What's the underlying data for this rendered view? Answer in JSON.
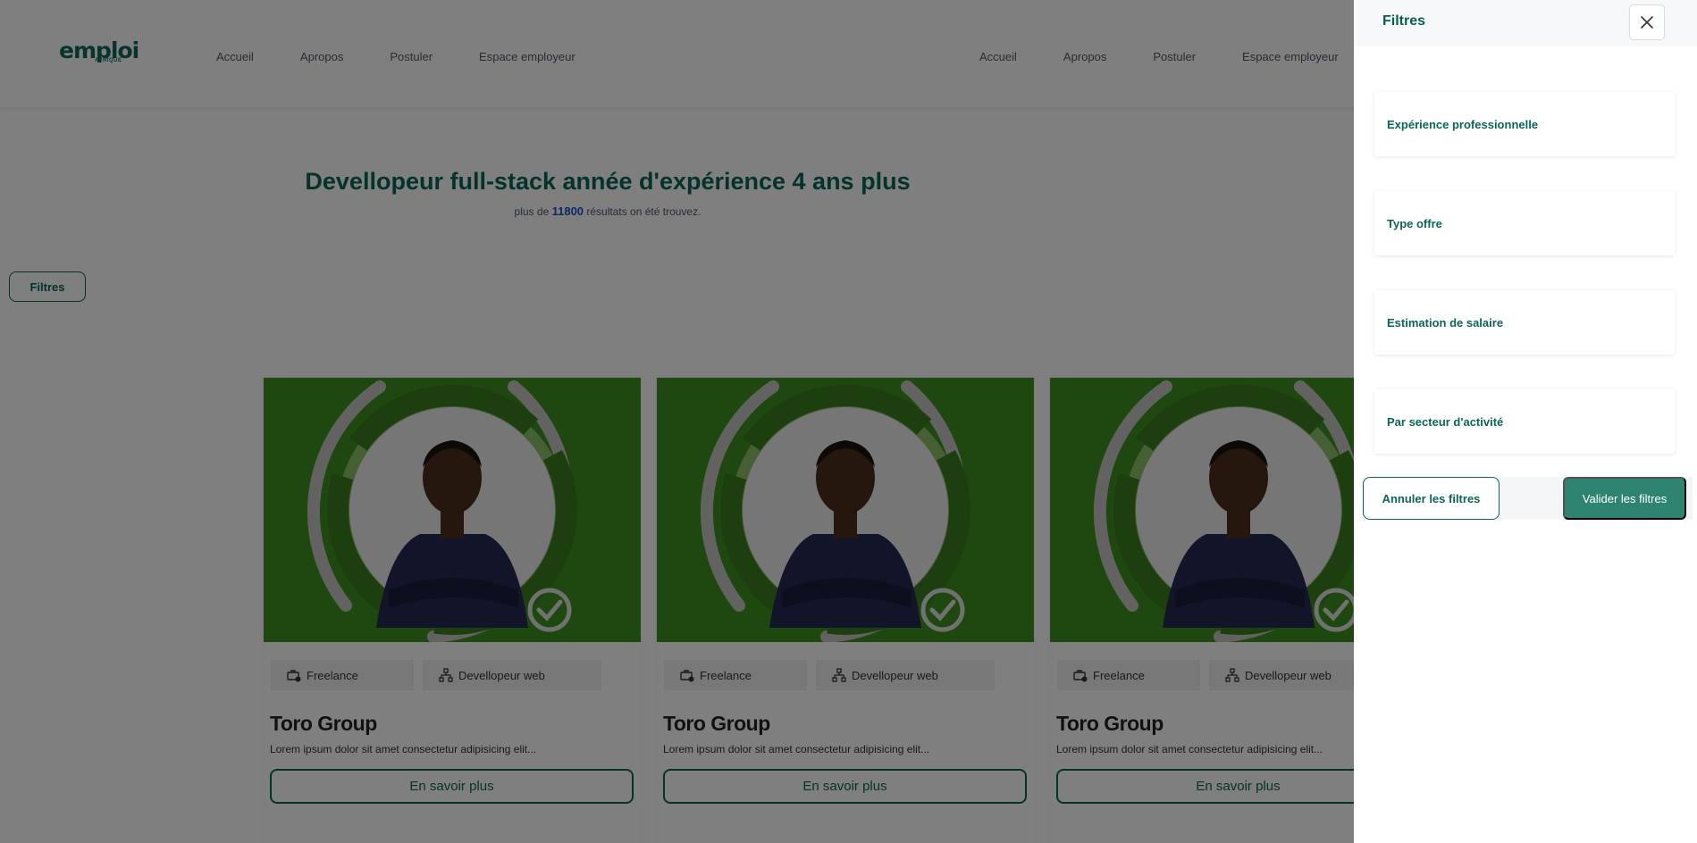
{
  "header": {
    "logo_text": "emploi",
    "logo_sub": "AFRIQUE",
    "nav_left": [
      "Accueil",
      "Apropos",
      "Postuler",
      "Espace employeur"
    ],
    "nav_right": [
      "Accueil",
      "Apropos",
      "Postuler",
      "Espace employeur"
    ]
  },
  "hero": {
    "title": "Devellopeur full-stack année d'expérience 4 ans plus",
    "sub_prefix": "plus de",
    "count": "11800",
    "sub_suffix": "résultats on été trouvez."
  },
  "filters_button": "Filtres",
  "cards": [
    {
      "tag1": "Freelance",
      "tag2": "Devellopeur web",
      "title": "Toro Group",
      "desc": "Lorem ipsum dolor sit amet consectetur adipisicing elit...",
      "button": "En savoir plus"
    },
    {
      "tag1": "Freelance",
      "tag2": "Devellopeur web",
      "title": "Toro Group",
      "desc": "Lorem ipsum dolor sit amet consectetur adipisicing elit...",
      "button": "En savoir plus"
    },
    {
      "tag1": "Freelance",
      "tag2": "Devellopeur web",
      "title": "Toro Group",
      "desc": "Lorem ipsum dolor sit amet consectetur adipisicing elit...",
      "button": "En savoir plus"
    }
  ],
  "drawer": {
    "title": "Filtres",
    "sections": [
      "Expérience professionnelle",
      "Type offre",
      "Estimation de salaire",
      "Par secteur d'activité"
    ],
    "cancel_label": "Annuler les filtres",
    "apply_label": "Valider les filtres"
  },
  "colors": {
    "brand": "#0b6657",
    "accent_button": "#2f8471",
    "count_blue": "#1553c2",
    "card_image_green": "#3f8f21"
  },
  "icons": {
    "close": "close-icon",
    "freelance": "briefcase-icon",
    "category": "sitemap-icon",
    "verified": "check-circle-icon"
  }
}
